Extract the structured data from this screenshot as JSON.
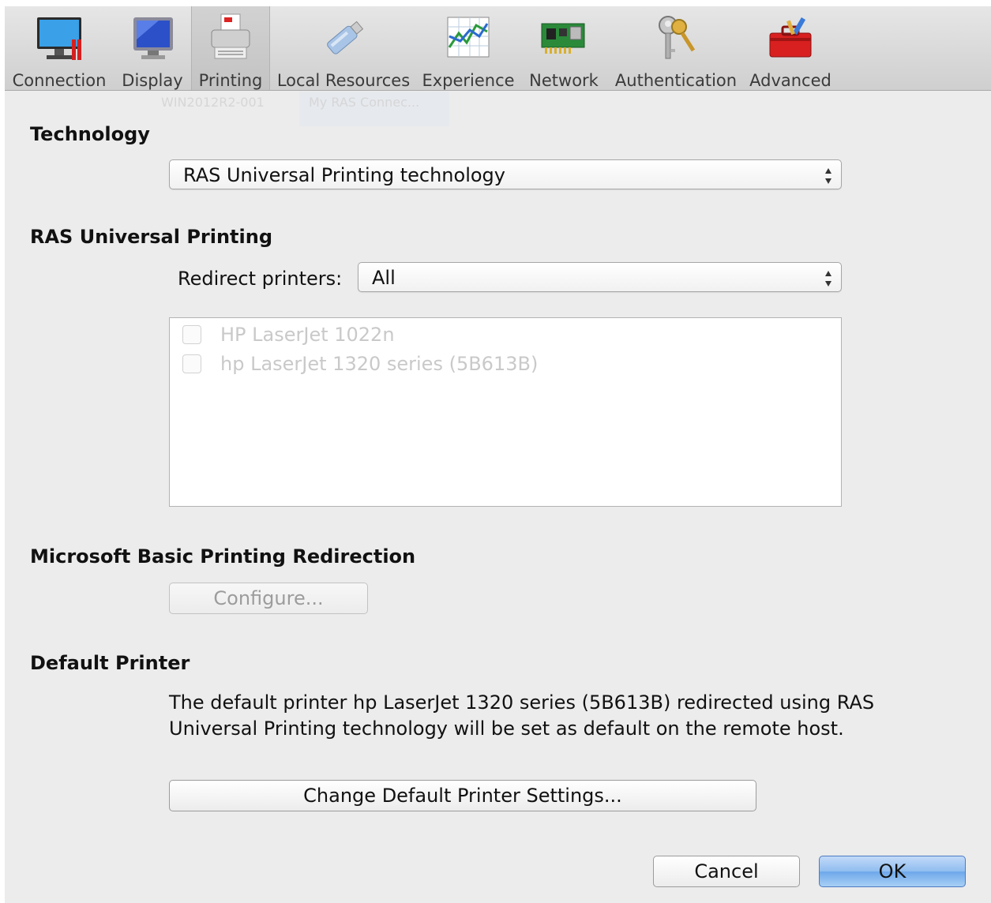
{
  "toolbar": {
    "items": [
      {
        "label": "Connection"
      },
      {
        "label": "Display"
      },
      {
        "label": "Printing"
      },
      {
        "label": "Local Resources"
      },
      {
        "label": "Experience"
      },
      {
        "label": "Network"
      },
      {
        "label": "Authentication"
      },
      {
        "label": "Advanced"
      }
    ],
    "selected": "Printing"
  },
  "background_ghost": {
    "left_text": "WIN2012R2-001",
    "right_text": "My RAS Connec..."
  },
  "technology": {
    "title": "Technology",
    "selected_value": "RAS Universal Printing technology"
  },
  "ras_universal": {
    "title": "RAS Universal Printing",
    "redirect_label": "Redirect printers:",
    "redirect_value": "All",
    "printers": [
      {
        "name": "HP LaserJet 1022n",
        "checked": false
      },
      {
        "name": "hp LaserJet 1320 series (5B613B)",
        "checked": false
      }
    ]
  },
  "microsoft_basic": {
    "title": "Microsoft Basic Printing Redirection",
    "configure_label": "Configure..."
  },
  "default_printer": {
    "title": "Default Printer",
    "description": "The default printer hp LaserJet 1320 series (5B613B) redirected using RAS Universal Printing technology will be set as default on the remote host.",
    "change_button_label": "Change Default Printer Settings..."
  },
  "footer": {
    "cancel_label": "Cancel",
    "ok_label": "OK"
  },
  "colors": {
    "window_bg": "#ececec",
    "default_button": "#8fbdf0",
    "disabled_text": "#c9c9c9"
  }
}
